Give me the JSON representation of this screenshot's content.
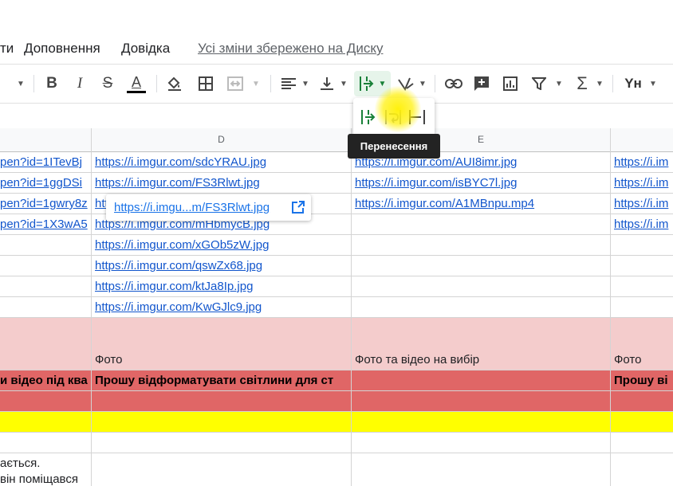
{
  "menu": {
    "items": [
      "ти",
      "Доповнення",
      "Довідка"
    ],
    "saved_status": "Усі зміни збережено на Диску"
  },
  "toolbar": {
    "icons": [
      "font-size-caret",
      "bold",
      "italic",
      "strikethrough",
      "text-color",
      "fill-color",
      "borders",
      "merge-cells",
      "horizontal-align",
      "vertical-align",
      "text-wrapping",
      "text-rotation",
      "insert-link",
      "insert-comment",
      "insert-chart",
      "filter",
      "functions",
      "input-tools"
    ],
    "bold_label": "B",
    "italic_label": "I",
    "strike_label": "S",
    "textcolor_label": "A",
    "sigma_label": "Σ",
    "input_tools_label": "Yн",
    "accent_color": "#188038"
  },
  "wrap_menu": {
    "options": [
      "overflow",
      "wrap",
      "clip"
    ],
    "tooltip": "Перенесення"
  },
  "columns": [
    "D",
    "E"
  ],
  "rows": {
    "links_c": [
      "pen?id=1ITevBj",
      "pen?id=1ggDSi",
      "pen?id=1gwry8z",
      "pen?id=1X3wA5"
    ],
    "links_d": [
      "https://i.imgur.com/sdcYRAU.jpg",
      "https://i.imgur.com/FS3Rlwt.jpg",
      "htt",
      "https://i.imgur.com/mHbmycB.jpg",
      "https://i.imgur.com/xGOb5zW.jpg",
      "https://i.imgur.com/qswZx68.jpg",
      "https://i.imgur.com/ktJa8Ip.jpg",
      "https://i.imgur.com/KwGJlc9.jpg"
    ],
    "links_e": [
      "https://i.imgur.com/AUI8imr.jpg",
      "https://i.imgur.com/isBYC7l.jpg",
      "https://i.imgur.com/A1MBnpu.mp4"
    ],
    "links_f": [
      "https://i.im",
      "https://i.im",
      "https://i.im",
      "https://i.im"
    ],
    "pink_d": "Фото",
    "pink_e": "Фото та відео на вибір",
    "pink_f": "Фото",
    "red_c": "и відео під ква",
    "red_d": "Прошу відформатувати світлини для ст",
    "red_f": "Прошу ві",
    "text_c1": "ається.",
    "text_c2": "він поміщався"
  },
  "link_popup": {
    "text": "https://i.imgu...m/FS3Rlwt.jpg"
  },
  "colors": {
    "pink": "#f4cccc",
    "red": "#e06666",
    "yellow": "#ffff00",
    "link": "#1155cc"
  }
}
